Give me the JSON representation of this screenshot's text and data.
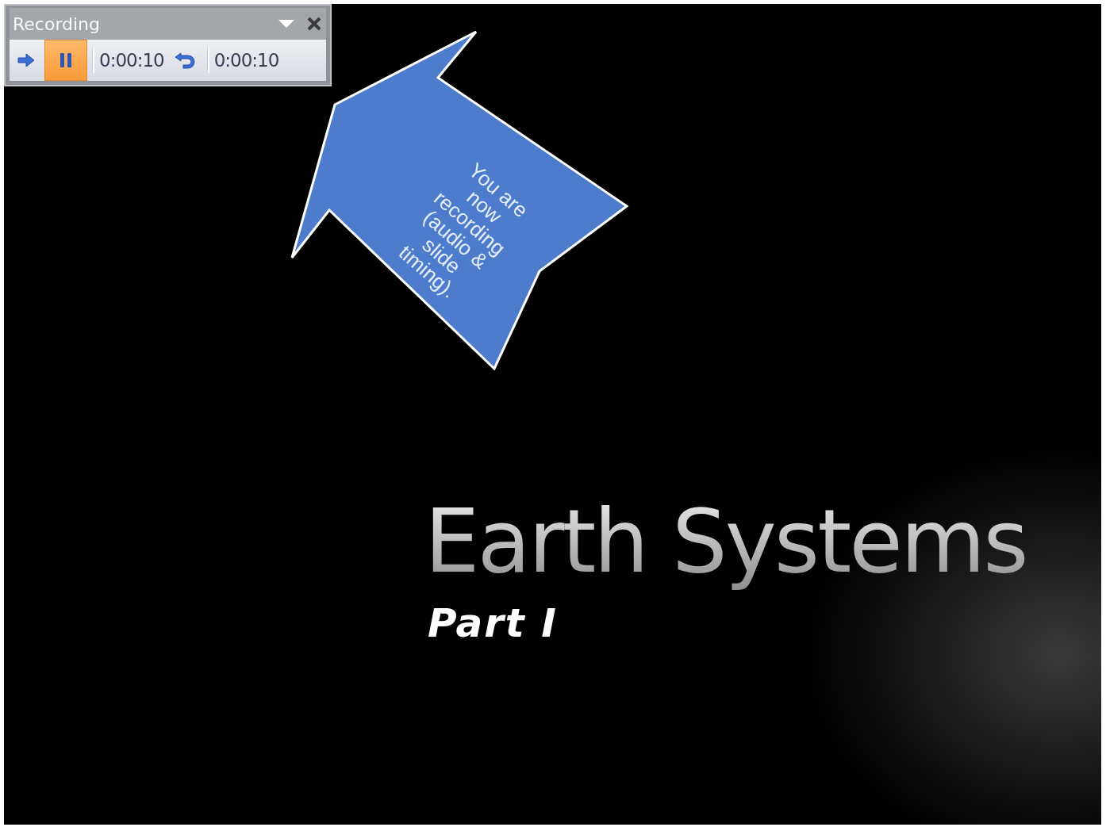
{
  "toolbar": {
    "title": "Recording",
    "slide_time": "0:00:10",
    "total_time": "0:00:10"
  },
  "slide": {
    "callout": "You are now recording (audio & slide timing).",
    "title": "Earth Systems",
    "subtitle": "Part I"
  }
}
